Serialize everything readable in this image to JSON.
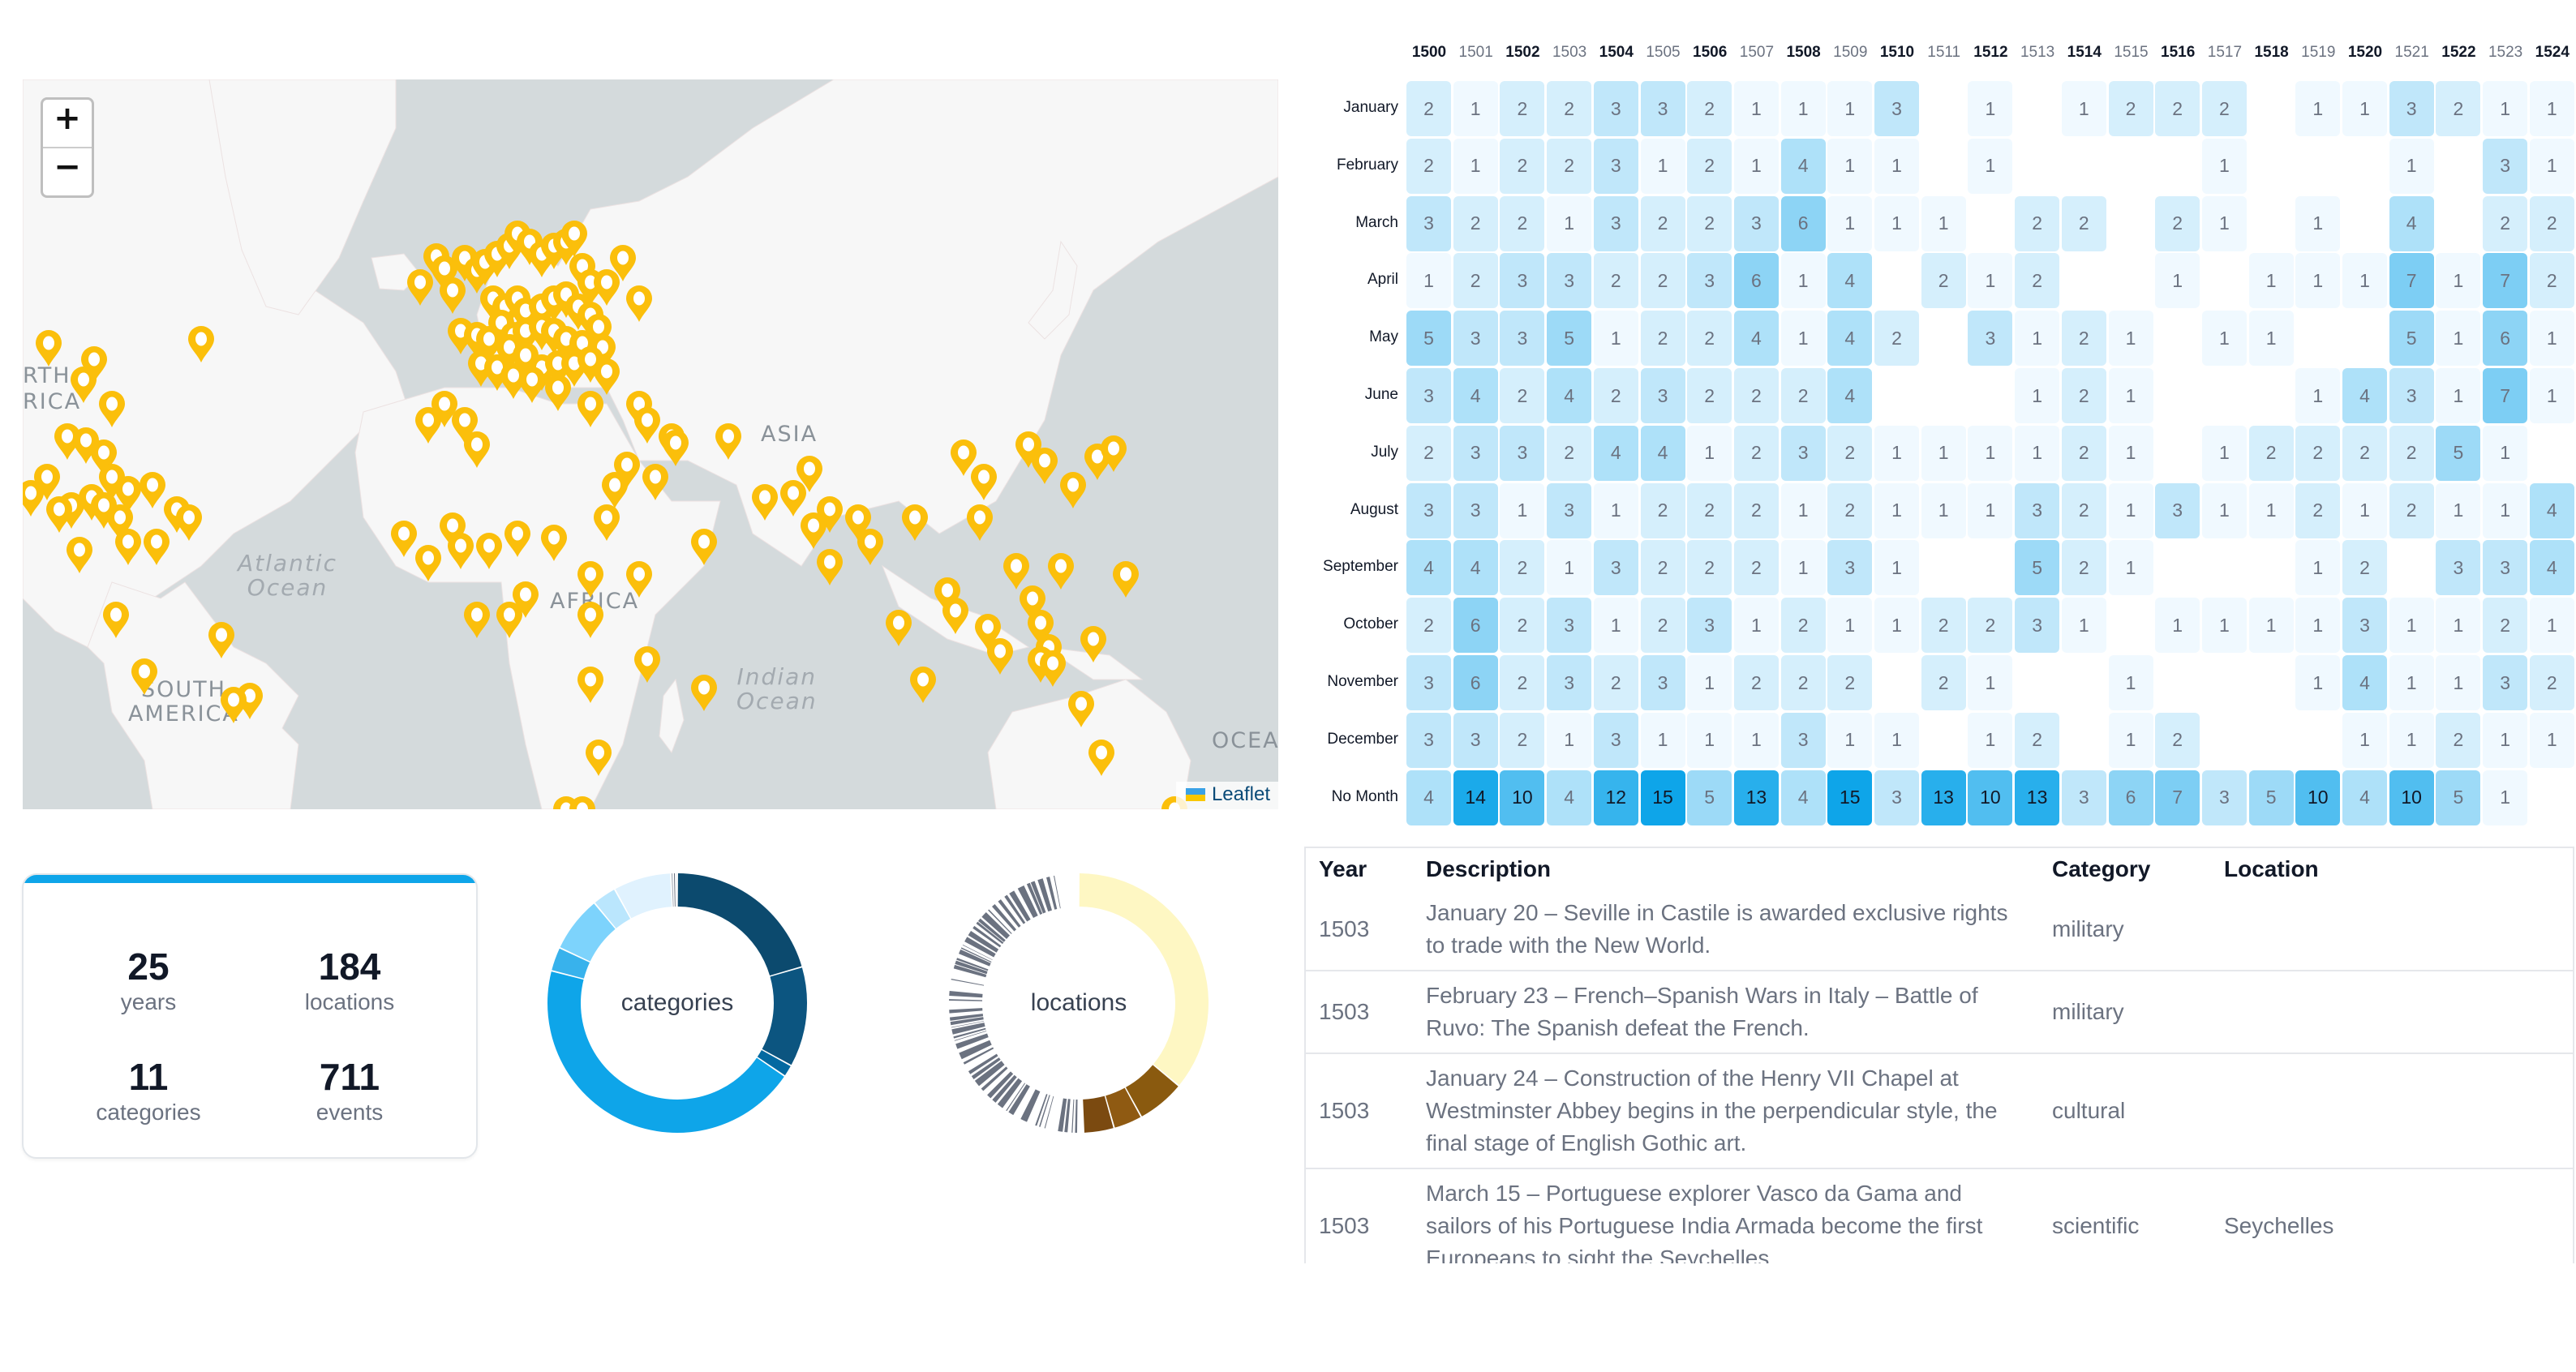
{
  "map": {
    "zoom_in_label": "+",
    "zoom_out_label": "−",
    "attribution": "Leaflet",
    "labels": {
      "north_america": "RTH\nRICA",
      "atlantic": "Atlantic\nOcean",
      "south_america": "SOUTH\nAMERICA",
      "africa": "AFRICA",
      "asia": "ASIA",
      "indian": "Indian\nOcean",
      "oceania": "OCEA"
    },
    "marker_color": "#fbbf0b",
    "marker_icon": "map-pin-icon"
  },
  "stats": {
    "accent": "#0ea5e9",
    "items": [
      {
        "value": "25",
        "label": "years"
      },
      {
        "value": "184",
        "label": "locations"
      },
      {
        "value": "11",
        "label": "categories"
      },
      {
        "value": "711",
        "label": "events"
      }
    ]
  },
  "donuts": {
    "categories": {
      "label": "categories",
      "slices": [
        {
          "value": 20.5,
          "color": "#0c4a6e"
        },
        {
          "value": 12.5,
          "color": "#0c5580"
        },
        {
          "value": 1.5,
          "color": "#0369a1"
        },
        {
          "value": 44.5,
          "color": "#0ea5e9"
        },
        {
          "value": 3.0,
          "color": "#38b2ec"
        },
        {
          "value": 7.0,
          "color": "#7dd3fc"
        },
        {
          "value": 3.0,
          "color": "#bae6fd"
        },
        {
          "value": 7.2,
          "color": "#e0f2fe"
        },
        {
          "value": 0.3,
          "color": "#9ca3af"
        },
        {
          "value": 0.3,
          "color": "#6b7280"
        },
        {
          "value": 0.2,
          "color": "#4b5563"
        }
      ]
    },
    "locations": {
      "label": "locations",
      "main_slices": [
        {
          "value": 36,
          "color": "#fef7c3"
        },
        {
          "value": 6.0,
          "color": "#8a5a0f"
        },
        {
          "value": 3.6,
          "color": "#8f5a12"
        },
        {
          "value": 3.8,
          "color": "#7b4a10"
        }
      ],
      "minor_color": "#6b7280"
    }
  },
  "chart_data": {
    "type": "heatmap",
    "title": "",
    "x": [
      "1500",
      "1501",
      "1502",
      "1503",
      "1504",
      "1505",
      "1506",
      "1507",
      "1508",
      "1509",
      "1510",
      "1511",
      "1512",
      "1513",
      "1514",
      "1515",
      "1516",
      "1517",
      "1518",
      "1519",
      "1520",
      "1521",
      "1522",
      "1523",
      "1524"
    ],
    "y": [
      "January",
      "February",
      "March",
      "April",
      "May",
      "June",
      "July",
      "August",
      "September",
      "October",
      "November",
      "December",
      "No Month"
    ],
    "values": [
      [
        2,
        1,
        2,
        2,
        3,
        3,
        2,
        1,
        1,
        1,
        3,
        null,
        1,
        null,
        1,
        2,
        2,
        2,
        null,
        1,
        1,
        3,
        2,
        1,
        1
      ],
      [
        2,
        1,
        2,
        2,
        3,
        1,
        2,
        1,
        4,
        1,
        1,
        null,
        1,
        null,
        null,
        null,
        null,
        1,
        null,
        null,
        null,
        1,
        null,
        3,
        1
      ],
      [
        3,
        2,
        2,
        1,
        3,
        2,
        2,
        3,
        6,
        1,
        1,
        1,
        null,
        2,
        2,
        null,
        2,
        1,
        null,
        1,
        null,
        4,
        null,
        2,
        2
      ],
      [
        1,
        2,
        3,
        3,
        2,
        2,
        3,
        6,
        1,
        4,
        null,
        2,
        1,
        2,
        null,
        null,
        1,
        null,
        1,
        1,
        1,
        7,
        1,
        7,
        2
      ],
      [
        5,
        3,
        3,
        5,
        1,
        2,
        2,
        4,
        1,
        4,
        2,
        null,
        3,
        1,
        2,
        1,
        null,
        1,
        1,
        null,
        null,
        5,
        1,
        6,
        1
      ],
      [
        3,
        4,
        2,
        4,
        2,
        3,
        2,
        2,
        2,
        4,
        null,
        null,
        null,
        1,
        2,
        1,
        null,
        null,
        null,
        1,
        4,
        3,
        1,
        7,
        1
      ],
      [
        2,
        3,
        3,
        2,
        4,
        4,
        1,
        2,
        3,
        2,
        1,
        1,
        1,
        1,
        2,
        1,
        null,
        1,
        2,
        2,
        2,
        2,
        5,
        1,
        null
      ],
      [
        3,
        3,
        1,
        3,
        1,
        2,
        2,
        2,
        1,
        2,
        1,
        1,
        1,
        3,
        2,
        1,
        3,
        1,
        1,
        2,
        1,
        2,
        1,
        1,
        4
      ],
      [
        4,
        4,
        2,
        1,
        3,
        2,
        2,
        2,
        1,
        3,
        1,
        null,
        null,
        5,
        2,
        1,
        null,
        null,
        null,
        1,
        2,
        null,
        3,
        3,
        4
      ],
      [
        2,
        6,
        2,
        3,
        1,
        2,
        3,
        1,
        2,
        1,
        1,
        2,
        2,
        3,
        1,
        null,
        1,
        1,
        1,
        1,
        3,
        1,
        1,
        2,
        1
      ],
      [
        3,
        6,
        2,
        3,
        2,
        3,
        1,
        2,
        2,
        2,
        null,
        2,
        1,
        null,
        null,
        1,
        null,
        null,
        null,
        1,
        4,
        1,
        1,
        3,
        2
      ],
      [
        3,
        3,
        2,
        1,
        3,
        1,
        1,
        1,
        3,
        1,
        1,
        null,
        1,
        2,
        null,
        1,
        2,
        null,
        null,
        null,
        1,
        1,
        2,
        1,
        1
      ],
      [
        4,
        14,
        10,
        4,
        12,
        15,
        5,
        13,
        4,
        15,
        3,
        13,
        10,
        13,
        3,
        6,
        7,
        3,
        5,
        10,
        4,
        10,
        5,
        1,
        null
      ]
    ],
    "color_scale": {
      "min": 1,
      "max": 15,
      "low_color": "#f0f9ff",
      "high_color": "#0ea5e9"
    }
  },
  "table": {
    "headers": {
      "year": "Year",
      "description": "Description",
      "category": "Category",
      "location": "Location"
    },
    "rows": [
      {
        "year": "1503",
        "description": "January 20 – Seville in Castile is awarded exclusive rights to trade with the New World.",
        "category": "military",
        "location": ""
      },
      {
        "year": "1503",
        "description": "February 23 – French–Spanish Wars in Italy – Battle of Ruvo: The Spanish defeat the French.",
        "category": "military",
        "location": ""
      },
      {
        "year": "1503",
        "description": "January 24 – Construction of the Henry VII Chapel at Westminster Abbey begins in the perpendicular style, the final stage of English Gothic art.",
        "category": "cultural",
        "location": ""
      },
      {
        "year": "1503",
        "description": "March 15 – Portuguese explorer Vasco da Gama and sailors of his Portuguese India Armada become the first Europeans to sight the Seychelles",
        "category": "scientific",
        "location": "Seychelles"
      }
    ]
  }
}
